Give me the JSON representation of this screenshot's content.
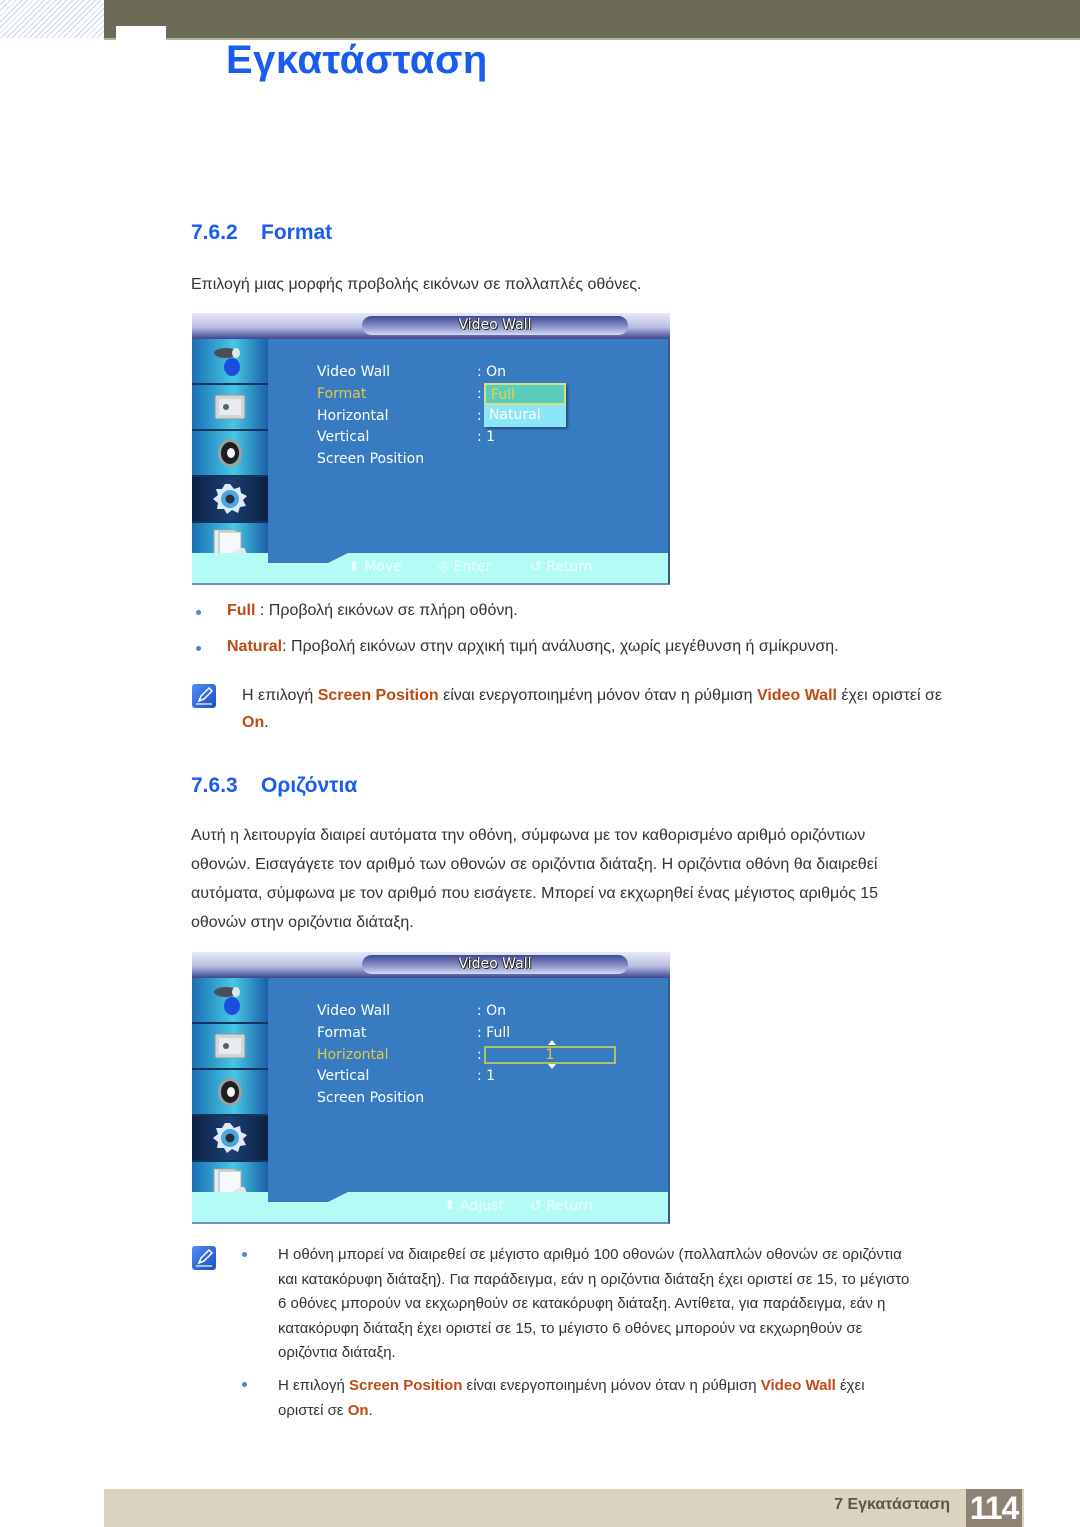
{
  "header": {
    "chapter_title": "Εγκατάσταση"
  },
  "section_format": {
    "number": "7.6.2",
    "title": "Format",
    "intro": "Επιλογή μιας μορφής προβολής εικόνων σε πολλαπλές οθόνες.",
    "osd": {
      "title": "Video Wall",
      "menu_rows": [
        {
          "label": "Video Wall",
          "value": ": On",
          "selected": false
        },
        {
          "label": "Format",
          "value": ":",
          "selected": true
        },
        {
          "label": "Horizontal",
          "value": ":",
          "selected": false
        },
        {
          "label": "Vertical",
          "value": ": 1",
          "selected": false
        },
        {
          "label": "Screen Position",
          "value": "",
          "selected": false
        }
      ],
      "dropdown_options": [
        "Full",
        "Natural"
      ],
      "dropdown_selected": "Full",
      "footer": {
        "move": "Move",
        "enter": "Enter",
        "return": "Return"
      },
      "side_icons": [
        "picture-icon",
        "screen-icon",
        "speaker-icon",
        "setup-gear-icon",
        "multi-screen-icon"
      ],
      "active_side_icon": "setup-gear-icon"
    },
    "bullets": [
      {
        "term": "Full",
        "separator": " : ",
        "text": "Προβολή εικόνων σε πλήρη οθόνη."
      },
      {
        "term": "Natural",
        "separator": ": ",
        "text": "Προβολή εικόνων στην αρχική τιμή ανάλυσης, χωρίς μεγέθυνση ή σμίκρυνση."
      }
    ],
    "note": {
      "p1": "Η επιλογή ",
      "t1": "Screen Position",
      "p2": " είναι ενεργοποιημένη μόνον όταν η ρύθμιση ",
      "t2": "Video Wall",
      "p3": " έχει οριστεί σε",
      "t3": "On",
      "p4": "."
    }
  },
  "section_horizontal": {
    "number": "7.6.3",
    "title": "Οριζόντια",
    "paragraph_lines": [
      "Αυτή η λειτουργία διαιρεί αυτόματα την οθόνη, σύμφωνα με τον καθορισμένο αριθμό οριζόντιων",
      "οθονών. Εισαγάγετε τον αριθμό των οθονών σε οριζόντια διάταξη. Η οριζόντια οθόνη θα διαιρεθεί",
      "αυτόματα, σύμφωνα με τον αριθμό που εισάγετε. Μπορεί να εκχωρηθεί ένας μέγιστος αριθμός 15",
      "οθονών στην οριζόντια διάταξη."
    ],
    "osd": {
      "title": "Video Wall",
      "menu_rows": [
        {
          "label": "Video Wall",
          "value": ": On",
          "selected": false
        },
        {
          "label": "Format",
          "value": ": Full",
          "selected": false
        },
        {
          "label": "Horizontal",
          "value": ":",
          "selected": true
        },
        {
          "label": "Vertical",
          "value": ": 1",
          "selected": false
        },
        {
          "label": "Screen Position",
          "value": "",
          "selected": false
        }
      ],
      "spinner_value": "1",
      "footer": {
        "adjust": "Adjust",
        "return": "Return"
      },
      "active_side_icon": "setup-gear-icon"
    },
    "notes": [
      {
        "lines": [
          "Η οθόνη μπορεί να διαιρεθεί σε μέγιστο αριθμό 100 οθονών (πολλαπλών οθονών σε οριζόντια",
          "και κατακόρυφη διάταξη). Για παράδειγμα, εάν η οριζόντια διάταξη έχει οριστεί σε 15, το μέγιστο",
          "6 οθόνες μπορούν να εκχωρηθούν σε κατακόρυφη διάταξη. Αντίθετα, για παράδειγμα, εάν η",
          "κατακόρυφη διάταξη έχει οριστεί σε 15, το μέγιστο 6 οθόνες μπορούν να εκχωρηθούν σε",
          "οριζόντια διάταξη."
        ]
      },
      {
        "p1": "Η επιλογή ",
        "t1": "Screen Position",
        "p2": " είναι ενεργοποιημένη μόνον όταν η ρύθμιση ",
        "t2": "Video Wall",
        "p3": " έχει",
        "p4": "οριστεί σε ",
        "t3": "On",
        "p5": "."
      }
    ]
  },
  "footer": {
    "chapter_label": "7 Εγκατάσταση",
    "page_number": "114"
  },
  "colors": {
    "heading_blue": "#1a5cf0",
    "highlight_orange": "#c04a14",
    "osd_body": "#387bc1",
    "osd_selected_text": "#e4c84a",
    "top_bar": "#6c6b58",
    "footer_band": "#d9d3bf",
    "page_number_box": "#8d8273"
  }
}
